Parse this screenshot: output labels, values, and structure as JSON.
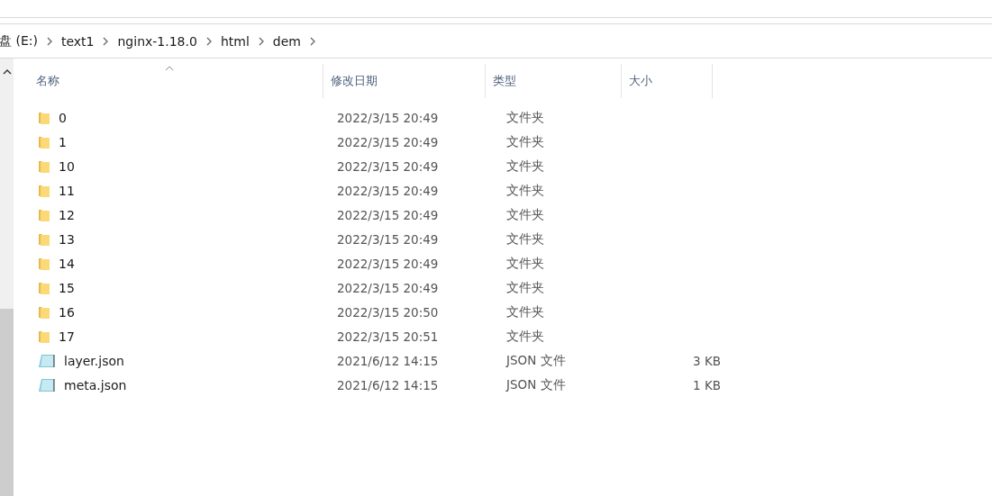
{
  "breadcrumb": [
    "盘 (E:)",
    "text1",
    "nginx-1.18.0",
    "html",
    "dem"
  ],
  "columns": [
    {
      "label": "名称",
      "sorted": true
    },
    {
      "label": "修改日期",
      "sorted": false
    },
    {
      "label": "类型",
      "sorted": false
    },
    {
      "label": "大小",
      "sorted": false
    }
  ],
  "rows": [
    {
      "kind": "folder",
      "name": "0",
      "date": "2022/3/15 20:49",
      "type": "文件夹"
    },
    {
      "kind": "folder",
      "name": "1",
      "date": "2022/3/15 20:49",
      "type": "文件夹"
    },
    {
      "kind": "folder",
      "name": "10",
      "date": "2022/3/15 20:49",
      "type": "文件夹"
    },
    {
      "kind": "folder",
      "name": "11",
      "date": "2022/3/15 20:49",
      "type": "文件夹"
    },
    {
      "kind": "folder",
      "name": "12",
      "date": "2022/3/15 20:49",
      "type": "文件夹"
    },
    {
      "kind": "folder",
      "name": "13",
      "date": "2022/3/15 20:49",
      "type": "文件夹"
    },
    {
      "kind": "folder",
      "name": "14",
      "date": "2022/3/15 20:49",
      "type": "文件夹"
    },
    {
      "kind": "folder",
      "name": "15",
      "date": "2022/3/15 20:49",
      "type": "文件夹"
    },
    {
      "kind": "folder",
      "name": "16",
      "date": "2022/3/15 20:50",
      "type": "文件夹"
    },
    {
      "kind": "folder",
      "name": "17",
      "date": "2022/3/15 20:51",
      "type": "文件夹"
    },
    {
      "kind": "file",
      "name": "layer.json",
      "date": "2021/6/12 14:15",
      "type": "JSON 文件",
      "size": "3 KB"
    },
    {
      "kind": "file",
      "name": "meta.json",
      "date": "2021/6/12 14:15",
      "type": "JSON 文件",
      "size": "1 KB"
    }
  ]
}
